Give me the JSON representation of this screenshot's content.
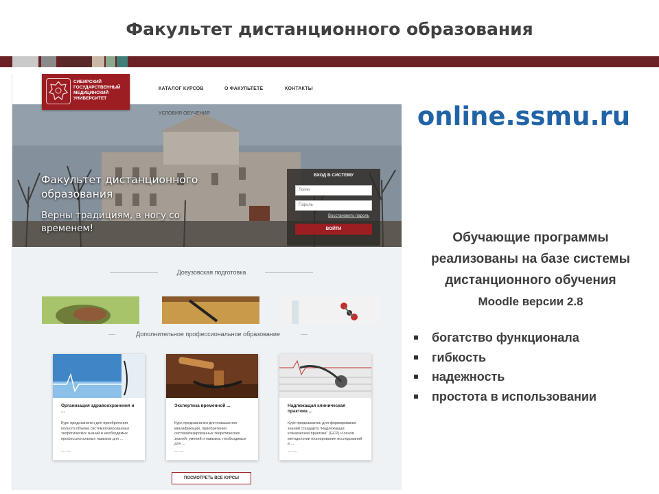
{
  "slide": {
    "title": "Факультет дистанционного образования",
    "band_colors": [
      "#6b2226",
      "#c9c9c9",
      "#8a8a8a",
      "#5a2828",
      "#c9b8a6",
      "#8aa88e",
      "#3f7f78"
    ]
  },
  "site": {
    "logo_text": "СИБИРСКИЙ ГОСУДАРСТВЕННЫЙ МЕДИЦИНСКИЙ УНИВЕРСИТЕТ",
    "nav": [
      "КАТАЛОГ КУРСОВ",
      "О ФАКУЛЬТЕТЕ",
      "КОНТАКТЫ"
    ],
    "subnav": "УСЛОВИЯ ОБУЧЕНИЯ",
    "hero_title_1": "Факультет дистанционного",
    "hero_title_2": "образования",
    "hero_sub_1": "Верны традициям, в ногу со",
    "hero_sub_2": "временем!",
    "login": {
      "title": "ВХОД В СИСТЕМУ",
      "login_placeholder": "Логин",
      "password_placeholder": "Пароль",
      "forgot": "Восстановить пароль",
      "button": "ВОЙТИ"
    },
    "section1": "Довузовская подготовка",
    "section2": "Дополнительное профессиональное образование",
    "cards": [
      {
        "title": "Организация здравоохранения и ...",
        "text": "Курс предназначен для приобретения полного объема систематизированных теоретических знаний и необходимых профессиональных навыков для ..."
      },
      {
        "title": "Экспертиза временной ...",
        "text": "Курс предназначен для повышения квалификации, приобретения систематизированных теоретических знаний, умений и навыков, необходимых для ..."
      },
      {
        "title": "Надлежащая клиническая практика ...",
        "text": "Курс предназначен для формирования знаний стандарта \"Надлежащая клиническая практика\" (GCP) и основ методологии планирования исследований в ..."
      }
    ],
    "card_dots": "—  —",
    "all_courses": "ПОСМОТРЕТЬ ВСЕ КУРСЫ"
  },
  "right": {
    "url": "online.ssmu.ru",
    "desc": [
      "Обучающие программы",
      "реализованы на базе системы",
      "дистанционного обучения",
      "Moodle версии 2.8"
    ],
    "bullets": [
      "богатство функционала",
      "гибкость",
      "надежность",
      "простота в использовании"
    ]
  }
}
